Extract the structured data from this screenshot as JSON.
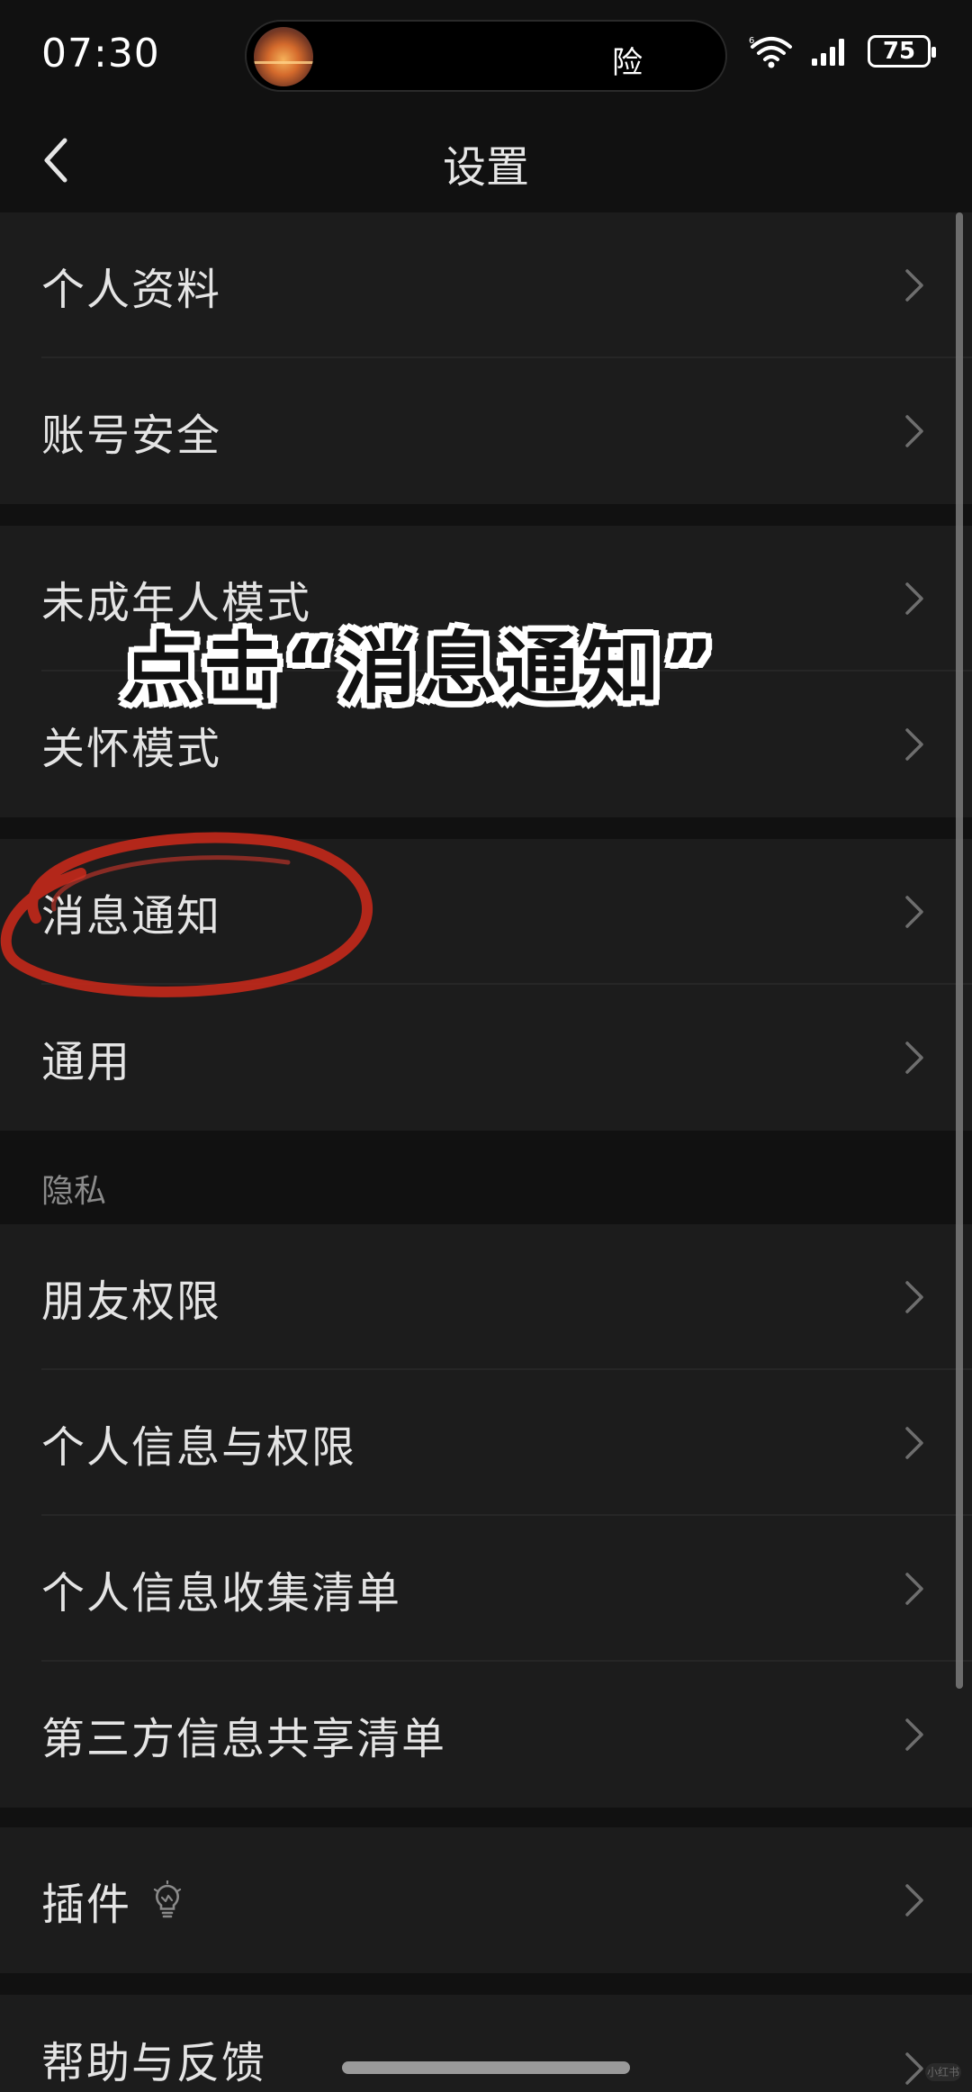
{
  "status_bar": {
    "time": "07:30",
    "island_text": "险",
    "battery": "75"
  },
  "nav": {
    "title": "设置"
  },
  "groups": [
    {
      "items": [
        {
          "label": "个人资料"
        },
        {
          "label": "账号安全"
        }
      ]
    },
    {
      "items": [
        {
          "label": "未成年人模式"
        },
        {
          "label": "关怀模式"
        }
      ]
    },
    {
      "items": [
        {
          "label": "消息通知"
        },
        {
          "label": "通用"
        }
      ]
    },
    {
      "header": "隐私",
      "items": [
        {
          "label": "朋友权限"
        },
        {
          "label": "个人信息与权限"
        },
        {
          "label": "个人信息收集清单"
        },
        {
          "label": "第三方信息共享清单"
        }
      ]
    },
    {
      "items": [
        {
          "label": "插件"
        }
      ]
    },
    {
      "items": [
        {
          "label": "帮助与反馈"
        }
      ]
    }
  ],
  "annotation": {
    "text": "点击“消息通知”",
    "circle_color": "#c0281a"
  },
  "colors": {
    "background": "#111111",
    "row_background": "#1c1c1c",
    "text": "#e4e4e4",
    "annotation_stroke": "#ffffff"
  },
  "icons": {
    "back": "chevron-left-icon",
    "row": "chevron-right-icon",
    "plugin": "bulb-icon",
    "wifi": "wifi-icon",
    "signal": "signal-icon",
    "battery": "battery-icon"
  },
  "watermark": "小红书"
}
